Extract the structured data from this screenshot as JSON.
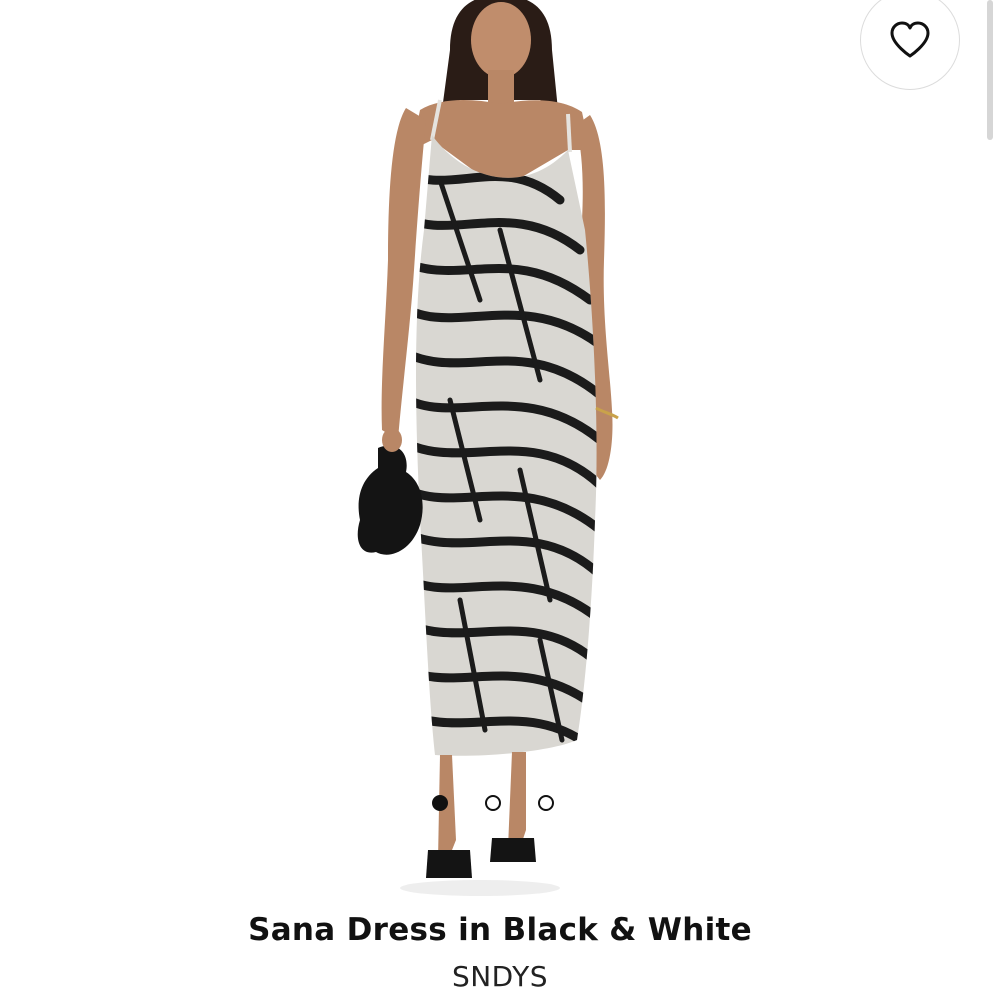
{
  "product": {
    "title": "Sana Dress in Black & White",
    "brand": "SNDYS"
  },
  "gallery": {
    "image_count": 3,
    "active_index": 0
  },
  "wishlist": {
    "icon": "heart-outline-icon"
  },
  "colors": {
    "text": "#111111",
    "dress_light": "#d9d7d2",
    "dress_stripe": "#1b1b1b",
    "skin": "#b98766",
    "hair": "#2a1c16"
  }
}
